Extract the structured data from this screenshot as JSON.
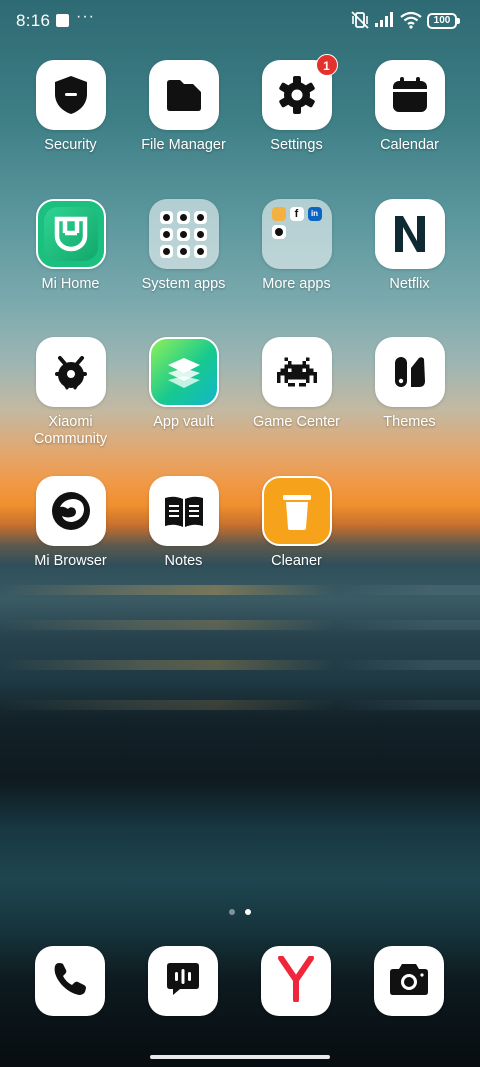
{
  "status_bar": {
    "time": "8:16",
    "battery": "100",
    "icons": [
      "image-icon",
      "more-dots-icon",
      "vibrate-off-icon",
      "signal-icon",
      "wifi-icon",
      "battery-icon"
    ]
  },
  "apps": [
    {
      "label": "Security",
      "icon": "shield-icon"
    },
    {
      "label": "File Manager",
      "icon": "folder-icon"
    },
    {
      "label": "Settings",
      "icon": "gear-icon",
      "badge": "1"
    },
    {
      "label": "Calendar",
      "icon": "calendar-icon"
    },
    {
      "label": "Mi Home",
      "icon": "mi-home-icon"
    },
    {
      "label": "System apps",
      "icon": "folder-system-apps"
    },
    {
      "label": "More apps",
      "icon": "folder-more-apps"
    },
    {
      "label": "Netflix",
      "icon": "netflix-icon"
    },
    {
      "label": "Xiaomi Community",
      "icon": "xiaomi-community-icon"
    },
    {
      "label": "App vault",
      "icon": "layers-icon"
    },
    {
      "label": "Game Center",
      "icon": "space-invader-icon"
    },
    {
      "label": "Themes",
      "icon": "themes-icon"
    },
    {
      "label": "Mi Browser",
      "icon": "browser-icon"
    },
    {
      "label": "Notes",
      "icon": "book-icon"
    },
    {
      "label": "Cleaner",
      "icon": "trash-icon"
    }
  ],
  "page_indicator": {
    "pages": 2,
    "active": 2
  },
  "dock": [
    {
      "name": "phone",
      "icon": "phone-icon"
    },
    {
      "name": "messages",
      "icon": "message-icon"
    },
    {
      "name": "yandex",
      "icon": "yandex-icon"
    },
    {
      "name": "camera",
      "icon": "camera-icon"
    }
  ],
  "colors": {
    "badge": "#e5312b",
    "mi_home": "#1bbf7f",
    "cleaner": "#f7a21b",
    "netflix_n": "#0f2a33"
  }
}
